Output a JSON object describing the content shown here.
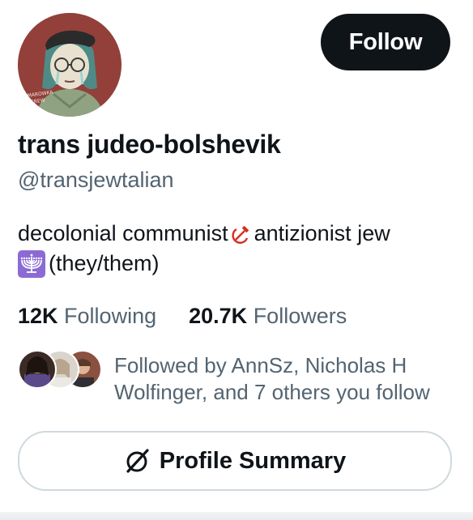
{
  "profile": {
    "display_name": "trans judeo-bolshevik",
    "handle": "@transjewtalian",
    "avatar_icon": "avatar-illustration",
    "follow_label": "Follow"
  },
  "bio": {
    "line1_before": "decolonial communist",
    "line1_icon": "hammer-sickle-icon",
    "line1_after": "antizionist jew",
    "line2_icon": "menorah-icon",
    "line2_text": "(they/them)"
  },
  "stats": {
    "following_count": "12K",
    "following_label": "Following",
    "followers_count": "20.7K",
    "followers_label": "Followers"
  },
  "followed_by": {
    "text": "Followed by AnnSz, Nicholas H Wolfinger, and 7 others you follow"
  },
  "actions": {
    "summary_label": "Profile Summary",
    "summary_icon": "grok-slash-circle-icon"
  },
  "colors": {
    "primary_text": "#0f1419",
    "secondary_text": "#536471",
    "follow_bg": "#0f1419",
    "border": "#cfd9de",
    "menorah_bg": "#8b6bd3"
  }
}
